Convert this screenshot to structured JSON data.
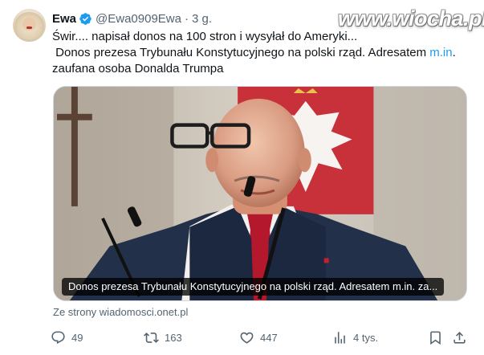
{
  "watermark": "www.wiocha.pl",
  "author": {
    "name": "Ewa",
    "handle": "@Ewa0909Ewa",
    "separator": "·",
    "time": "3 g.",
    "verified_color": "#1d9bf0"
  },
  "tweet": {
    "line1": "Świr.... napisał donos na 100 stron i wysyłał do Ameryki...",
    "line2_before": " Donos prezesa Trybunału Konstytucyjnego na polski rząd. Adresatem ",
    "line2_link": "m.in",
    "line2_after": ".",
    "line3": "zaufana osoba Donalda Trumpa"
  },
  "media": {
    "caption": "Donos prezesa Trybunału Konstytucyjnego na polski rząd. Adresatem m.in. za..."
  },
  "source": "Ze strony wiadomosci.onet.pl",
  "actions": {
    "reply": {
      "icon": "reply-icon",
      "count": "49"
    },
    "retweet": {
      "icon": "retweet-icon",
      "count": "163"
    },
    "like": {
      "icon": "like-icon",
      "count": "447"
    },
    "views": {
      "icon": "views-icon",
      "count": "4 tys."
    },
    "bookmark": {
      "icon": "bookmark-icon"
    },
    "share": {
      "icon": "share-icon"
    }
  },
  "colors": {
    "link": "#1d9bf0",
    "secondary_text": "#536471",
    "primary_text": "#0f1419"
  }
}
